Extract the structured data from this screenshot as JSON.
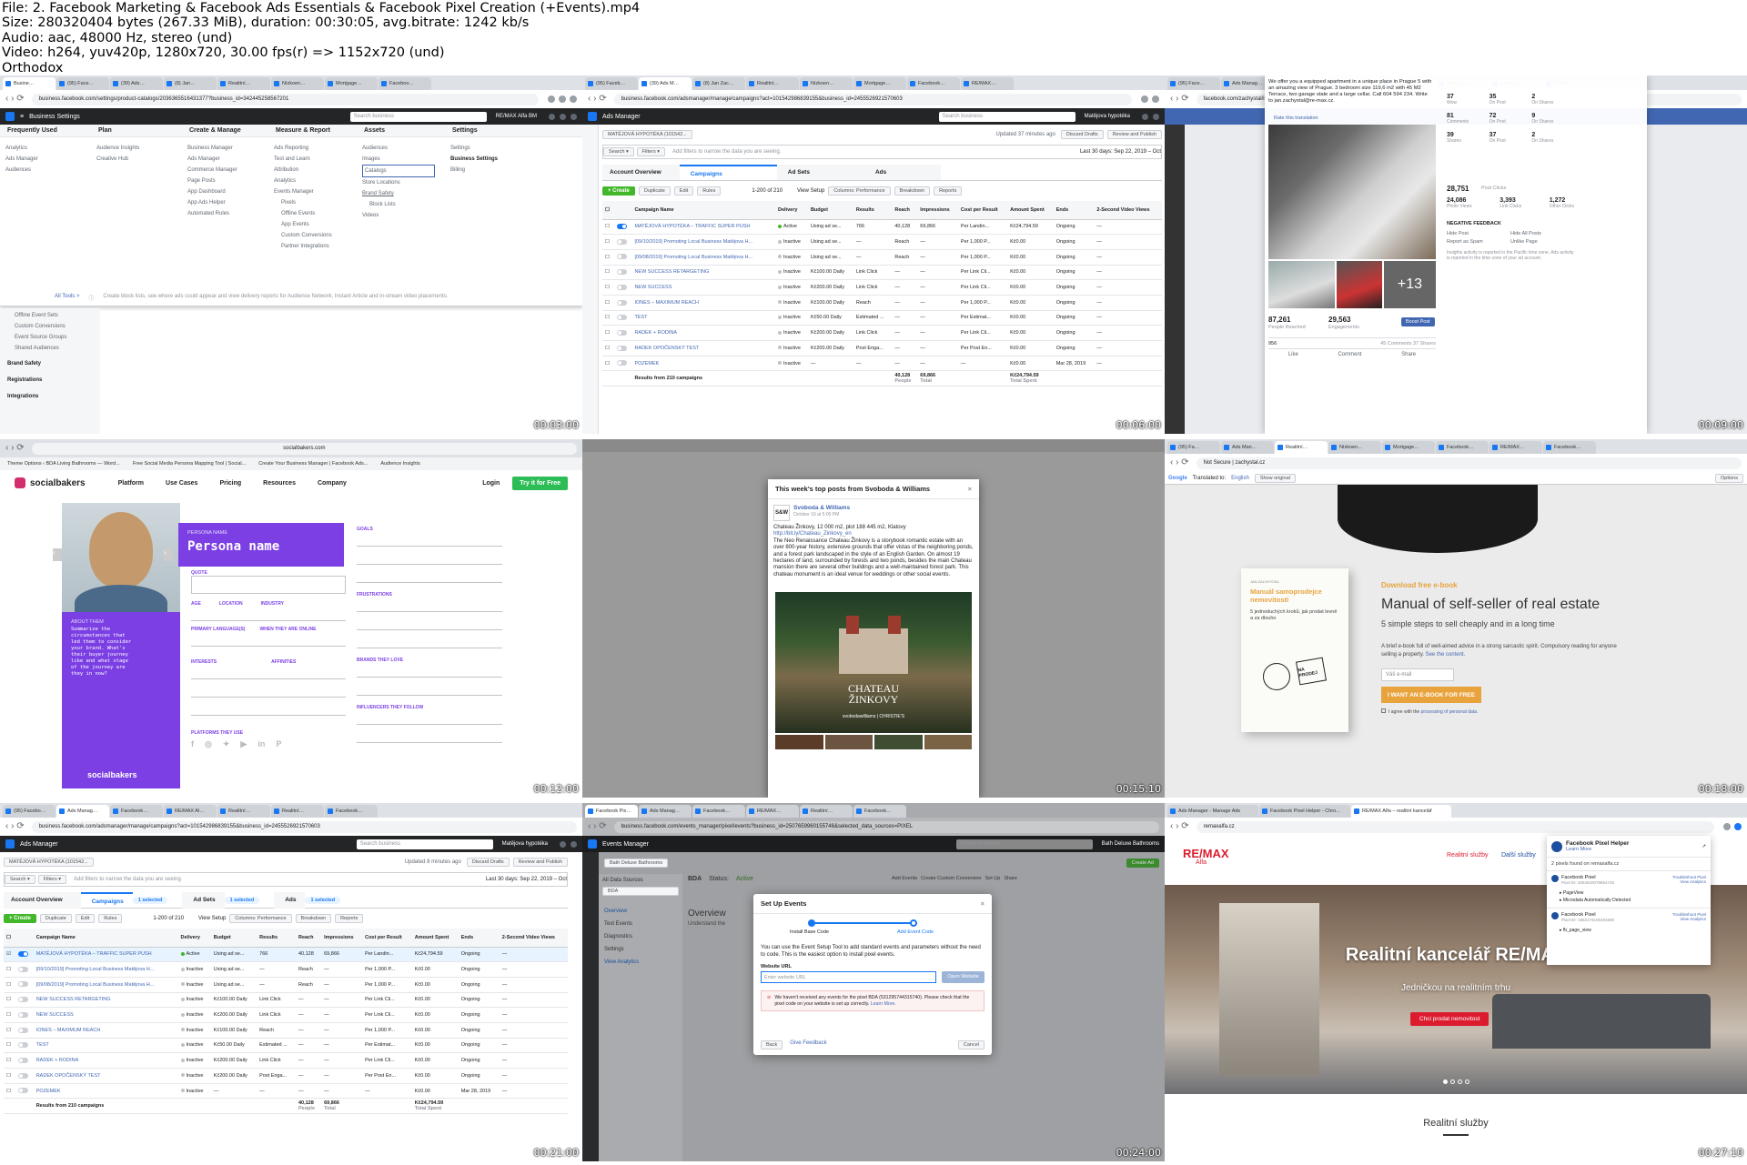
{
  "header": {
    "file": "File: 2. Facebook Marketing & Facebook Ads Essentials & Facebook Pixel Creation (+Events).mp4",
    "size": "Size: 280320404 bytes (267.33 MiB), duration: 00:30:05, avg.bitrate: 1242 kb/s",
    "audio": "Audio: aac, 48000 Hz, stereo (und)",
    "video": "Video: h264, yuv420p, 1280x720, 30.00 fps(r) => 1152x720 (und)",
    "brand": "Orthodox"
  },
  "timestamps": [
    "00:03:00",
    "00:06:00",
    "00:09:00",
    "00:12:00",
    "00:15:10",
    "00:18:00",
    "00:21:00",
    "00:24:00",
    "00:27:10"
  ],
  "t1": {
    "url": "business.facebook.com/settings/product-catalogs/2036365516431377?business_id=342445258567201",
    "title": "Business Settings",
    "search": "Search business",
    "account": "RE/MAX Alfa BM",
    "cols": [
      {
        "h": "Frequently Used",
        "items": [
          "Analytics",
          "Ads Manager",
          "Audiences"
        ]
      },
      {
        "h": "Plan",
        "items": [
          "Audience Insights",
          "Creative Hub"
        ]
      },
      {
        "h": "Create & Manage",
        "items": [
          "Business Manager",
          "Ads Manager",
          "Commerce Manager",
          "Page Posts",
          "App Dashboard",
          "App Ads Helper",
          "Automated Rules"
        ]
      },
      {
        "h": "Measure & Report",
        "items": [
          "Ads Reporting",
          "Test and Learn",
          "Attribution",
          "Analytics",
          "Events Manager",
          "Pixels",
          "Offline Events",
          "App Events",
          "Custom Conversions",
          "Partner Integrations"
        ]
      },
      {
        "h": "Assets",
        "items": [
          "Audiences",
          "Images",
          "Catalogs",
          "Store Locations",
          "Brand Safety",
          "Block Lists",
          "Videos"
        ]
      },
      {
        "h": "Settings",
        "items": [
          "Settings",
          "Business Settings",
          "Billing"
        ]
      }
    ],
    "alltools": "All Tools >",
    "footnote": "Create block lists, see where ads could appear and view delivery reports for Audience Network, Instant Article and in-stream video placements.",
    "side": [
      "Offline Event Sets",
      "Custom Conversions",
      "Event Source Groups",
      "Shared Audiences",
      "Brand Safety",
      "Registrations",
      "Integrations"
    ]
  },
  "campaigns": {
    "account": "MATĚJOVÁ HYPOTÉKA (101542...",
    "updated": "Updated 37 minutes ago",
    "range": "Last 30 days: Sep 22, 2019 – Oct",
    "filter_hint": "Add filters to narrow the data you are seeing.",
    "tabs": [
      "Account Overview",
      "Campaigns",
      "Ad Sets",
      "Ads"
    ],
    "create": "+ Create",
    "count": "1-200 of 210",
    "tools": [
      "Duplicate",
      "Edit",
      "Rules",
      "View Setup",
      "Columns: Performance",
      "Breakdown",
      "Reports"
    ],
    "cols": [
      "Campaign Name",
      "Delivery",
      "Budget",
      "Results",
      "Reach",
      "Impressions",
      "Cost per Result",
      "Amount Spent",
      "Ends",
      "2-Second Video Views"
    ],
    "rows": [
      [
        "MATĚJOVÁ HYPOTÉKA – TRAFFIC SUPER PUSH",
        "Active",
        "Using ad se...",
        "766",
        "40,128",
        "69,866",
        "Per Landin...",
        "Kč24,794.59",
        "Ongoing"
      ],
      [
        "[09/10/2019] Promoting Local Business Matějova H...",
        "Inactive",
        "Using ad se...",
        "—",
        "Reach",
        "—",
        "Per 1,000 P...",
        "Kč0.00",
        "Ongoing"
      ],
      [
        "[09/08/2019] Promoting Local Business Matějova H...",
        "Inactive",
        "Using ad se...",
        "—",
        "Reach",
        "—",
        "Per 1,000 P...",
        "Kč0.00",
        "Ongoing"
      ],
      [
        "NEW SUCCESS RETARGETING",
        "Inactive",
        "Kč100.00 Daily",
        "Link Click",
        "—",
        "—",
        "Per Link Cli...",
        "Kč0.00",
        "Ongoing"
      ],
      [
        "NEW SUCCESS",
        "Inactive",
        "Kč200.00 Daily",
        "Link Click",
        "—",
        "—",
        "Per Link Cli...",
        "Kč0.00",
        "Ongoing"
      ],
      [
        "IONES – MAXIMUM REACH",
        "Inactive",
        "Kč100.00 Daily",
        "Reach",
        "—",
        "—",
        "Per 1,000 P...",
        "Kč0.00",
        "Ongoing"
      ],
      [
        "TEST",
        "Inactive",
        "Kč50.00 Daily",
        "Estimated ...",
        "—",
        "—",
        "Per Estimat...",
        "Kč0.00",
        "Ongoing"
      ],
      [
        "RADEK + RODINA",
        "Inactive",
        "Kč200.00 Daily",
        "Link Click",
        "—",
        "—",
        "Per Link Cli...",
        "Kč0.00",
        "Ongoing"
      ],
      [
        "RADEK OPOČENSKÝ TEST",
        "Inactive",
        "Kč200.00 Daily",
        "Post Enga...",
        "—",
        "—",
        "Per Post En...",
        "Kč0.00",
        "Ongoing"
      ],
      [
        "POZEMEK",
        "Inactive",
        "—",
        "—",
        "—",
        "—",
        "—",
        "Kč0.00",
        "Mar 28, 2019"
      ]
    ],
    "total": [
      "Results from 210 campaigns",
      "40,128",
      "69,866",
      "Kč24,794.59"
    ],
    "total_sub": [
      "People",
      "Total",
      "Total Spent"
    ]
  },
  "t3": {
    "url": "facebook.com/zachystal/insights/?section=navPosts",
    "post_text": "We offer you a equipped apartment in a unique place in Prague 5 with an amazing view of Prague. 3 bedroom size 119,6 m2 with 45 M2 Terrace, two garage state and a large cellar. Call 604 594 234. Write to jan.zachystal@re-max.cz.",
    "translate": "Rate this translation",
    "more": "+13",
    "reached": "87,261",
    "reached_l": "People Reached",
    "eng": "29,563",
    "eng_l": "Engagements",
    "boost": "Boost Post",
    "comments_shares": "45 Comments 37 Shares",
    "likes_n": "956",
    "actions": [
      "Like",
      "Comment",
      "Share"
    ],
    "stats": [
      [
        "37",
        "Wow"
      ],
      [
        "35",
        "On Post"
      ],
      [
        "2",
        "On Shares"
      ],
      [
        "81",
        "Comments"
      ],
      [
        "72",
        "On Post"
      ],
      [
        "9",
        "On Shares"
      ],
      [
        "39",
        "Shares"
      ],
      [
        "37",
        "On Post"
      ],
      [
        "2",
        "On Shares"
      ]
    ],
    "clicks": "28,751",
    "clicks_l": "Post Clicks",
    "c3": [
      [
        "24,086",
        "Photo Views"
      ],
      [
        "3,393",
        "Link Clicks"
      ],
      [
        "1,272",
        "Other Clicks"
      ]
    ],
    "neg": "NEGATIVE FEEDBACK",
    "neg_items": [
      "Hide Post",
      "Hide All Posts",
      "Report as Spam",
      "Unlike Page"
    ],
    "note": "Insights activity is reported in the Pacific time zone. Ads activity is reported in the time zone of your ad account."
  },
  "t4": {
    "url": "socialbakers.com",
    "tabs": [
      "Theme Options ‹ BDA Living Bathrooms — Word...",
      "Free Social Media Persona Mapping Tool | Social...",
      "Create Your Business Manager | Facebook Ads...",
      "Audience Insights"
    ],
    "brand": "socialbakers",
    "nav": [
      "Platform",
      "Use Cases",
      "Pricing",
      "Resources",
      "Company"
    ],
    "login": "Login",
    "try": "Try it for Free",
    "pname_l": "PERSONA NAME",
    "pname": "Persona name",
    "quote": "QUOTE",
    "age": "AGE",
    "location": "LOCATION",
    "industry": "INDUSTRY",
    "lang": "PRIMARY LANGUAGE(S)",
    "online": "WHEN THEY ARE ONLINE",
    "interests": "INTERESTS",
    "affinities": "AFFINITIES",
    "goals": "GOALS",
    "frustrations": "FRUSTRATIONS",
    "brands": "BRANDS THEY LOVE",
    "influencers": "INFLUENCERS THEY FOLLOW",
    "platforms": "PLATFORMS THEY USE",
    "about": "ABOUT THEM",
    "about_text": "Summarize the circumstances that led them to consider your brand. What's their buyer journey like and what stage of the journey are they in now?"
  },
  "t5": {
    "title": "This week's top posts from Svoboda & Williams",
    "page": "Svoboda & Williams",
    "date": "October 16 at 5:00 PM",
    "line1": "Chateau Žinkovy, 12 000 m2, plot 188 445 m2, Klatovy",
    "link": "http://bit.ly/Chateau_Zinkovy_en",
    "body": "The Neo Renaissance Chateau Žinkovy is a storybook romantic estate with an over 800-year history, extensive grounds that offer vistas of the neighboring ponds, and a forest park landscaped in the style of an English Garden. On almost 19 hectares of land, surrounded by forests and two ponds, besides the main Chateau mansion there are several other buildings and a well-maintained forest park. This chateau monument is an ideal venue for weddings or other social events.",
    "img_title": "CHATEAU\nŽINKOVY",
    "img_sub": "svobodawilliams | CHRISTIE'S"
  },
  "t6": {
    "url": "Not Secure | zachystal.cz",
    "translated": "Translated to:",
    "lang": "English",
    "show": "Show original",
    "options": "Options",
    "book_author": "JAN ZACHYSTAL",
    "book_title": "Manuál samoprodejce nemovitostí",
    "book_sub": "5 jednoduchých kroků, jak prodat levně a za dlouho",
    "sign": "NA PRODEJ",
    "kicker": "Download free e-book",
    "title": "Manual of self-seller of real estate",
    "sub": "5 simple steps to sell cheaply and in a long time",
    "desc": "A brief e-book full of well-aimed advice in a strong sarcastic spirit. Compulsory reading for anyone selling a property.",
    "see": "See the content.",
    "email": "Váš e-mail",
    "cta": "I WANT AN E-BOOK FOR FREE",
    "agree": "I agree with the",
    "agree_link": "processing of personal data."
  },
  "t7": {
    "updated": "Updated 8 minutes ago",
    "selected": "1 selected"
  },
  "t8": {
    "app": "Events Manager",
    "biz": "Bath Deluxe Bathrooms",
    "source_h": "All Data Sources",
    "source": "BDA",
    "pixel": "BDA",
    "status": "Status:",
    "active": "Active",
    "side": [
      "Overview",
      "Test Events",
      "Diagnostics",
      "Settings",
      "View Analytics"
    ],
    "overview": "Overview",
    "understand": "Understand the",
    "create_btn": "Create Ad",
    "btns": [
      "Add Events",
      "Create Custom Conversion",
      "Set Up",
      "Share"
    ],
    "modal_title": "Set Up Events",
    "step1": "Install Base Code",
    "step2": "Add Event Code",
    "modal_text": "You can use the Event Setup Tool to add standard events and parameters without the need to code. This is the easiest option to install pixel events.",
    "url_l": "Website URL",
    "url_ph": "Enter website URL",
    "open": "Open Website",
    "warn": "We haven't received any events for the pixel BDA (531295744315740). Please check that the pixel code on your website is set up correctly.",
    "learn": "Learn More.",
    "back": "Back",
    "feedback": "Give Feedback",
    "cancel": "Cancel"
  },
  "t9": {
    "url": "remaxalfa.cz",
    "tabs": [
      "Ads Manager - Manage Ads",
      "Facebook Pixel Helper - Chro...",
      "RE/MAX Alfa – realitní kancelář"
    ],
    "logo": "RE/MAX",
    "logo_sub": "Alfa",
    "nav": [
      "Realitní služby",
      "Další služby"
    ],
    "hero": "Realitní kancelář RE/MAX",
    "hero_sub": "Jedničkou na realitním trhu",
    "cta": "Chci prodat nemovitost",
    "section": "Realitní služby",
    "ph_title": "Facebook Pixel Helper",
    "ph_learn": "Learn More",
    "ph_found": "2 pixels found on remaxalfa.cz",
    "ph_pixel": "Facebook Pixel",
    "ph_trouble": "Troubleshoot Pixel",
    "ph_analytics": "View Analytics",
    "ph_id1": "Pixel ID: 2064532078854745",
    "ph_id2": "Pixel ID: 1852174105494696",
    "ph_ev": [
      "PageView",
      "Microdata Automatically Detected",
      "fb_page_view"
    ]
  },
  "colors": {
    "fb_blue": "#1877f2",
    "fb_dark": "#242526",
    "green": "#42b72a",
    "purple": "#7b3fe4",
    "remax_red": "#dc1c2e",
    "ebook_orange": "#e8a33d"
  }
}
